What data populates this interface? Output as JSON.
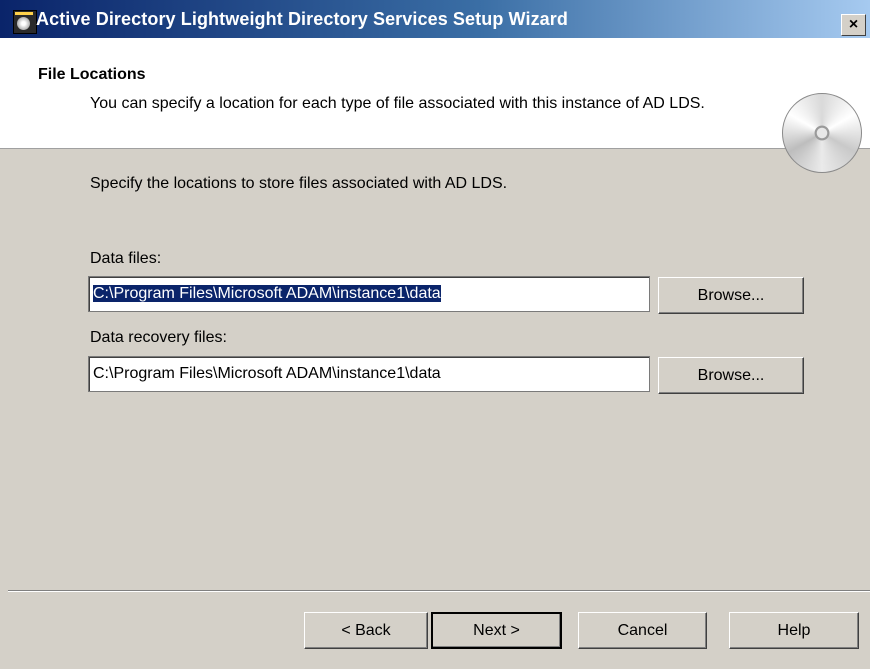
{
  "window": {
    "title": "Active Directory Lightweight Directory Services Setup Wizard",
    "close_label": "×"
  },
  "header": {
    "title": "File Locations",
    "subtitle": "You can specify a location for each type of file associated with this instance of AD LDS.",
    "icon": "cd-disc-icon"
  },
  "body": {
    "instructions": "Specify the locations to store files associated with AD LDS.",
    "data_files": {
      "label": "Data files:",
      "value": "C:\\Program Files\\Microsoft ADAM\\instance1\\data",
      "browse_label": "Browse..."
    },
    "recovery_files": {
      "label": "Data recovery files:",
      "value": "C:\\Program Files\\Microsoft ADAM\\instance1\\data",
      "browse_label": "Browse..."
    }
  },
  "footer": {
    "back_label": "< Back",
    "next_label": "Next >",
    "cancel_label": "Cancel",
    "help_label": "Help"
  },
  "colors": {
    "dialog_bg": "#d4d0c8",
    "title_bar_start": "#0a246a",
    "title_bar_end": "#a6caf0",
    "selection": "#0a246a"
  }
}
